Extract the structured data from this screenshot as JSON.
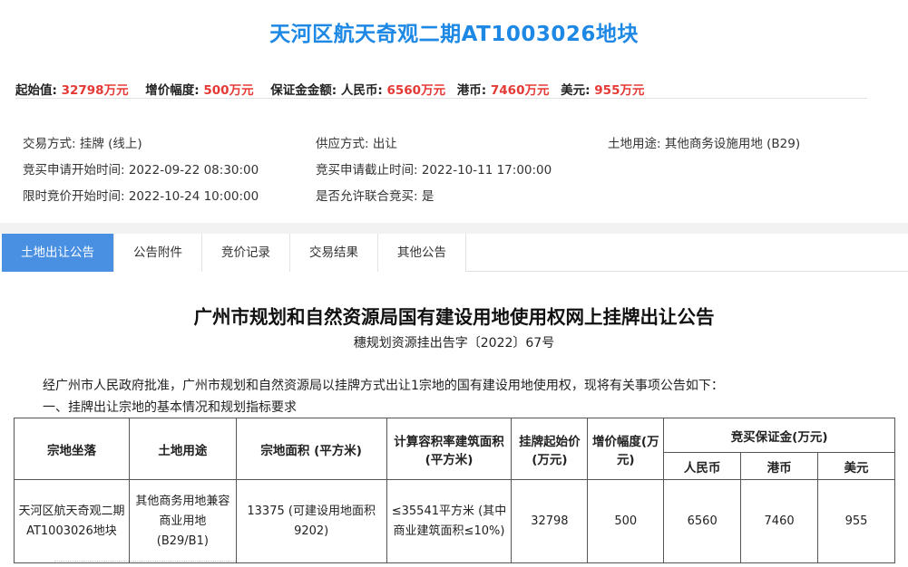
{
  "header": {
    "title": "天河区航天奇观二期AT1003026地块"
  },
  "prices": {
    "start_label": "起始值:",
    "start_value": "32798万元",
    "increment_label": "增价幅度:",
    "increment_value": "500万元",
    "deposit_label": "保证金金额:",
    "rmb_label": "人民币:",
    "rmb_value": "6560万元",
    "hkd_label": "港币:",
    "hkd_value": "7460万元",
    "usd_label": "美元:",
    "usd_value": "955万元"
  },
  "info": {
    "trade_mode": "交易方式:  挂牌 (线上)",
    "supply_mode": "供应方式:  出让",
    "land_use": "土地用途:  其他商务设施用地 (B29)",
    "apply_start": "竞买申请开始时间:  2022-09-22 08:30:00",
    "apply_end": "竞买申请截止时间:  2022-10-11 17:00:00",
    "bid_start": "限时竞价开始时间:  2022-10-24 10:00:00",
    "joint_bid": "是否允许联合竞买:  是"
  },
  "tabs": [
    {
      "label": "土地出让公告"
    },
    {
      "label": "公告附件"
    },
    {
      "label": "竞价记录"
    },
    {
      "label": "交易结果"
    },
    {
      "label": "其他公告"
    }
  ],
  "document": {
    "title": "广州市规划和自然资源局国有建设用地使用权网上挂牌出让公告",
    "subtitle": "穗规划资源挂出告字〔2022〕67号",
    "intro": "经广州市人民政府批准，广州市规划和自然资源局以挂牌方式出让1宗地的国有建设用地使用权，现将有关事项公告如下：",
    "section1": "一、挂牌出让宗地的基本情况和规划指标要求"
  },
  "table": {
    "headers": {
      "location": "宗地坐落",
      "use": "土地用途",
      "area": "宗地面积 (平方米)",
      "far_area": "计算容积率建筑面积(平方米)",
      "start_price": "挂牌起始价(万元)",
      "increment": "增价幅度(万元)",
      "deposit": "竞买保证金(万元)",
      "rmb": "人民币",
      "hkd": "港币",
      "usd": "美元"
    },
    "row": {
      "location": "天河区航天奇观二期AT1003026地块",
      "use": "其他商务用地兼容商业用地(B29/B1)",
      "area": "13375 (可建设用地面积9202)",
      "far_area": "≤35541平方米 (其中商业建筑面积≤10%)",
      "start_price": "32798",
      "increment": "500",
      "rmb": "6560",
      "hkd": "7460",
      "usd": "955"
    }
  },
  "colors": {
    "title_blue": "#1e88e5",
    "price_red": "#e53935",
    "tab_active": "#4a90e2"
  }
}
